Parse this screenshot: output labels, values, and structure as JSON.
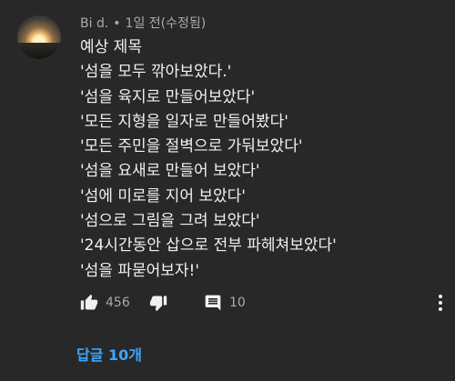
{
  "comment": {
    "author": "Bi d.",
    "separator": "•",
    "time": "1일 전(수정됨)",
    "lines": [
      "예상 제목",
      "'섬을 모두 깎아보았다.'",
      "'섬을 육지로 만들어보았다'",
      "'모든 지형을 일자로 만들어봤다'",
      "'모든 주민을 절벽으로 가둬보았다'",
      "'섬을 요새로 만들어 보았다'",
      "'섬에 미로를 지어 보았다'",
      "'섬으로 그림을 그려 보았다'",
      "'24시간동안 삽으로 전부 파헤쳐보았다'",
      "'섬을 파묻어보자!'"
    ]
  },
  "actions": {
    "like_count": "456",
    "reply_count": "10"
  },
  "replies_link": "답글 10개",
  "icons": {
    "like": "thumbs-up-icon",
    "dislike": "thumbs-down-icon",
    "comment": "comment-icon",
    "more": "more-vertical-icon"
  },
  "colors": {
    "background": "#282828",
    "text": "#f1f1f1",
    "secondary": "#aaaaaa",
    "link": "#3ea6ff"
  }
}
